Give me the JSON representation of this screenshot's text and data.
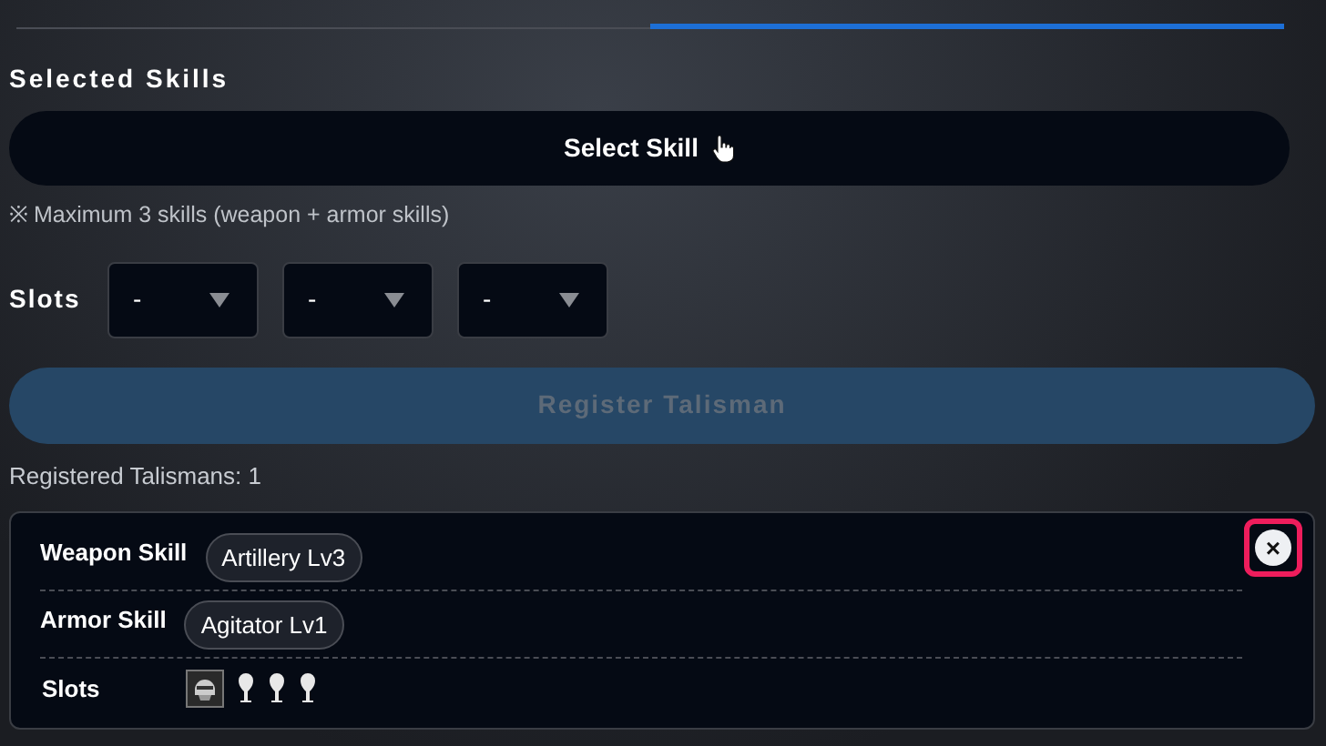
{
  "tabs": [
    {
      "selected": false
    },
    {
      "selected": true
    }
  ],
  "heading": "Selected Skills",
  "select_button": "Select Skill",
  "note": "※ Maximum 3 skills (weapon + armor skills)",
  "slots": {
    "label": "Slots",
    "selects": [
      {
        "value": "-"
      },
      {
        "value": "-"
      },
      {
        "value": "-"
      }
    ]
  },
  "register_button": {
    "label": "Register Talisman",
    "disabled": true
  },
  "registered_count": "Registered Talismans: 1",
  "talismans": [
    {
      "weapon_label": "Weapon Skill",
      "weapon_skill": "Artillery Lv3",
      "armor_label": "Armor Skill",
      "armor_skill": "Agitator Lv1",
      "slots_label": "Slots",
      "remove": "×",
      "highlighted": true,
      "slot_items": [
        {
          "kind": "decoration"
        },
        {
          "kind": "empty"
        },
        {
          "kind": "empty"
        },
        {
          "kind": "empty"
        }
      ]
    }
  ]
}
